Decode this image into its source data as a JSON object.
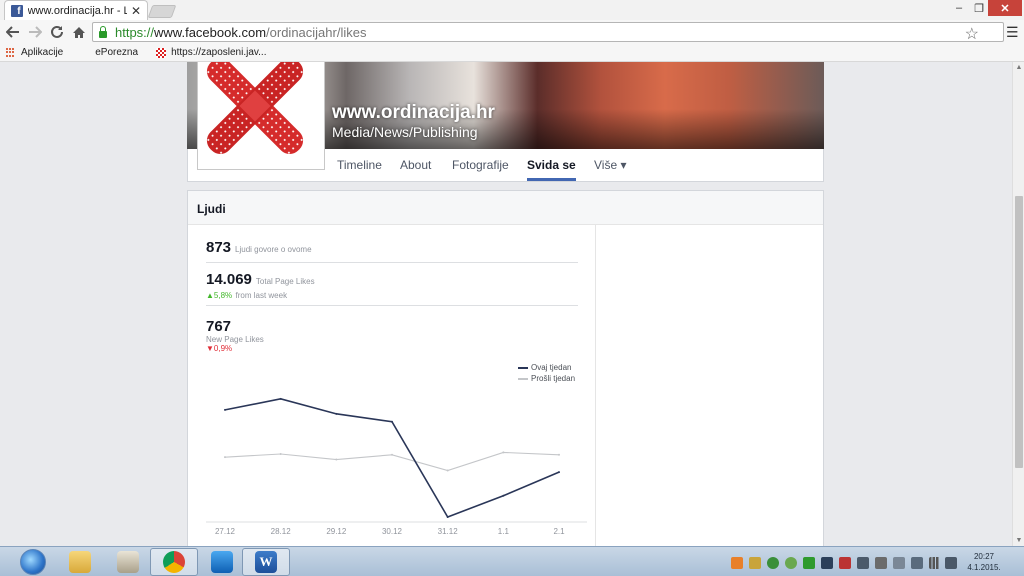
{
  "browser": {
    "tab_title": "www.ordinacija.hr - Likes",
    "tab_close": "✕",
    "window_minimize": "‒",
    "window_maximize": "❐",
    "window_close": "✕",
    "url": {
      "scheme": "https://",
      "host": "www.facebook.com",
      "path": "/ordinacijahr/likes"
    },
    "bookmarks": [
      "Aplikacije",
      "ePorezna",
      "https://zaposleni.jav..."
    ],
    "icons": [
      "back-icon",
      "forward-icon",
      "reload-icon",
      "home-icon",
      "lock-icon",
      "star-icon",
      "menu-icon"
    ]
  },
  "page": {
    "name": "www.ordinacija.hr",
    "category": "Media/News/Publishing",
    "tabs": [
      "Timeline",
      "About",
      "Fotografije",
      "Svida se",
      "Više ▾"
    ],
    "active_tab": "Svida se"
  },
  "people": {
    "header": "Ljudi",
    "talking_count": "873",
    "talking_label": "Ljudi govore o ovome",
    "total_likes": "14.069",
    "total_likes_label": "Total Page Likes",
    "total_trend_value": "▲5,8%",
    "total_trend_text": "from last week",
    "new_likes": "767",
    "new_likes_label": "New Page Likes",
    "new_trend_value": "▼0,9%"
  },
  "colors": {
    "facebook_blue": "#3b5998",
    "series_this_week": "#2a3658",
    "series_last_week": "#c4c6c9",
    "trend_up": "#42b72a",
    "trend_down": "#e02d37"
  },
  "chart_data": {
    "type": "line",
    "categories": [
      "27.12",
      "28.12",
      "29.12",
      "30.12",
      "31.12",
      "1.1",
      "2.1"
    ],
    "series": [
      {
        "name": "Ovaj tjedan",
        "values": [
          136,
          150,
          131,
          121,
          0,
          27,
          57
        ]
      },
      {
        "name": "Prošli tjedan",
        "values": [
          76,
          80,
          73,
          79,
          59,
          82,
          79
        ]
      }
    ],
    "title": "",
    "xlabel": "",
    "ylabel": "",
    "ylim": [
      0,
      160
    ],
    "grid": false,
    "legend": "top-right"
  },
  "taskbar": {
    "clock_time": "20:27",
    "clock_date": "4.1.2015."
  }
}
